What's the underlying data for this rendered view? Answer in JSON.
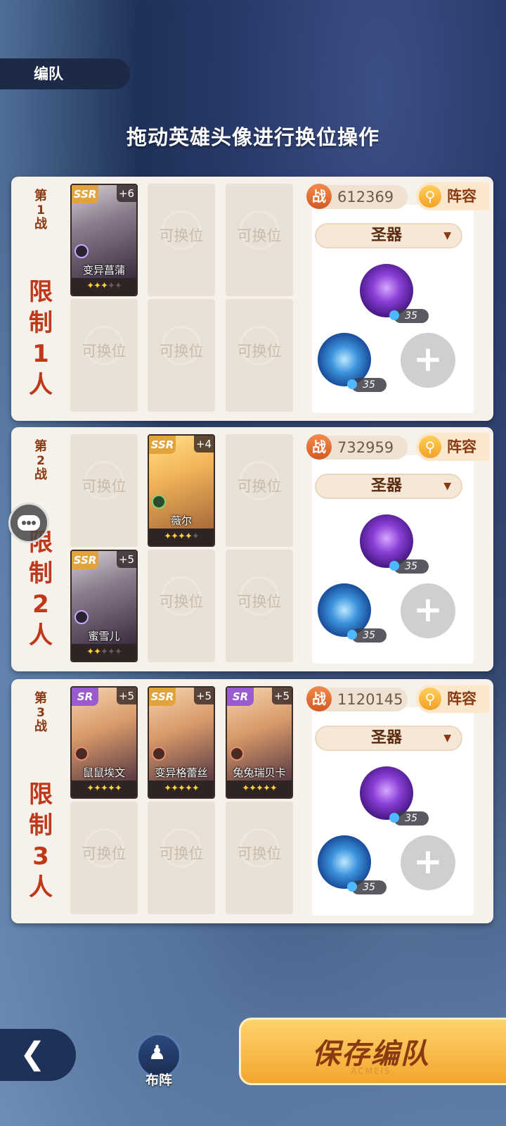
{
  "header": {
    "tab_label": "编队"
  },
  "instruction": "拖动英雄头像进行换位操作",
  "empty_slot_label": "可换位",
  "relic_level": "35",
  "battles": [
    {
      "label_top": "第",
      "label_num": "1",
      "label_bottom": "战",
      "limit": [
        "限",
        "制",
        "1",
        "人"
      ],
      "power_badge": "战",
      "power": "612369",
      "lineup_label": "阵容",
      "relic_select": "圣器",
      "heroes": [
        {
          "slot": 0,
          "rarity": "SSR",
          "plus": "+6",
          "name": "变异菖蒲",
          "stars_on": "✦✦✦",
          "stars_off": "✦✦",
          "element": "purple"
        }
      ]
    },
    {
      "label_top": "第",
      "label_num": "2",
      "label_bottom": "战",
      "limit": [
        "限",
        "制",
        "2",
        "人"
      ],
      "power_badge": "战",
      "power": "732959",
      "lineup_label": "阵容",
      "relic_select": "圣器",
      "heroes": [
        {
          "slot": 1,
          "rarity": "SSR",
          "plus": "+4",
          "name": "薇尔",
          "stars_on": "✦✦✦✦",
          "stars_off": "✦",
          "element": "green"
        },
        {
          "slot": 3,
          "rarity": "SSR",
          "plus": "+5",
          "name": "蜜雪儿",
          "stars_on": "✦✦",
          "stars_off": "✦✦✦",
          "element": "purple"
        }
      ]
    },
    {
      "label_top": "第",
      "label_num": "3",
      "label_bottom": "战",
      "limit": [
        "限",
        "制",
        "3",
        "人"
      ],
      "power_badge": "战",
      "power": "1120145",
      "lineup_label": "阵容",
      "relic_select": "圣器",
      "heroes": [
        {
          "slot": 0,
          "rarity": "SR",
          "plus": "+5",
          "name": "鼠鼠埃文",
          "stars_on": "✦✦✦✦✦",
          "stars_off": "",
          "element": "red"
        },
        {
          "slot": 1,
          "rarity": "SSR",
          "plus": "+5",
          "name": "变异格蕾丝",
          "stars_on": "✦✦✦✦✦",
          "stars_off": "",
          "element": "red"
        },
        {
          "slot": 2,
          "rarity": "SR",
          "plus": "+5",
          "name": "兔兔瑞贝卡",
          "stars_on": "✦✦✦✦✦",
          "stars_off": "",
          "element": "red"
        }
      ]
    }
  ],
  "footer": {
    "formation_label": "布阵",
    "save_label": "保存编队",
    "save_watermark": "ACMEIS"
  },
  "colors": {
    "panel_bg": "#f6f1ea",
    "accent_orange": "#f3a62e",
    "title_brown": "#8a3a12",
    "limit_red": "#c0381a",
    "ssr_gold": "#e2a33a",
    "sr_purple": "#9a5ad0"
  },
  "icons": [
    "back-arrow-icon",
    "formation-icon",
    "chat-icon",
    "search-icon",
    "add-icon",
    "dropdown-arrow-icon",
    "star-icon"
  ]
}
